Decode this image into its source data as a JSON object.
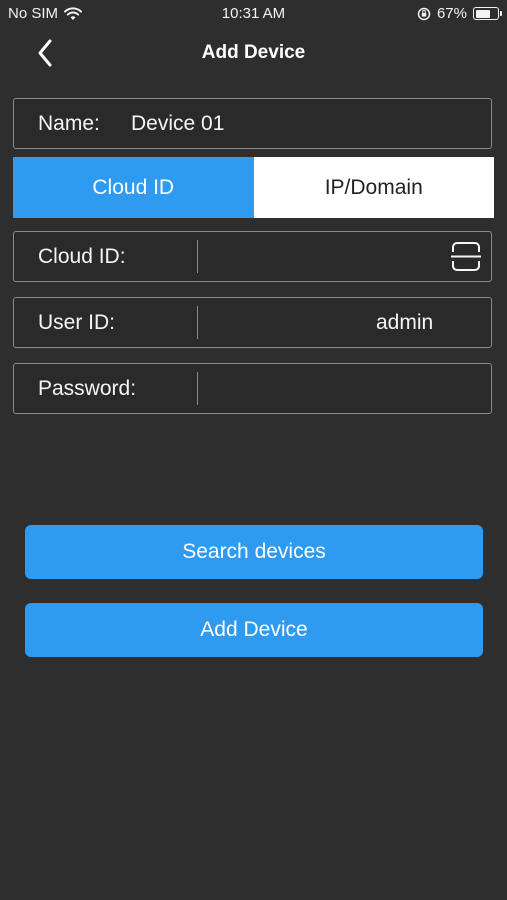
{
  "status_bar": {
    "carrier": "No SIM",
    "time": "10:31 AM",
    "battery_percent_label": "67%",
    "battery_level": 0.67,
    "icons": [
      "wifi-icon",
      "orientation-lock-icon",
      "battery-icon"
    ]
  },
  "nav": {
    "back_icon": "chevron-left-icon",
    "title": "Add Device"
  },
  "name_row": {
    "label": "Name:",
    "value": "Device 01"
  },
  "mode_tabs": {
    "tabs": [
      {
        "label": "Cloud ID",
        "active": true
      },
      {
        "label": "IP/Domain",
        "active": false
      }
    ],
    "active_color": "#2f9bf0"
  },
  "cloud_id_row": {
    "label": "Cloud ID:",
    "value": "",
    "scan_icon": "qr-scan-icon"
  },
  "user_id_row": {
    "label": "User ID:",
    "value": "admin"
  },
  "password_row": {
    "label": "Password:",
    "value": ""
  },
  "buttons": {
    "search_label": "Search devices",
    "add_label": "Add Device"
  },
  "colors": {
    "background": "#2e2e2e",
    "accent": "#2f9bf0",
    "border": "#8a8a8a"
  }
}
